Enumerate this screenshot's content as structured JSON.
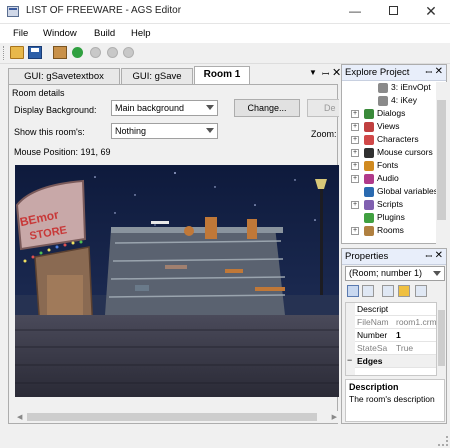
{
  "window": {
    "title": "LIST OF FREEWARE - AGS Editor",
    "minimize_glyph": "—",
    "close_glyph": "✕"
  },
  "menu": [
    "File",
    "Window",
    "Build",
    "Help"
  ],
  "toolbar": {
    "icons": [
      "open-folder-icon",
      "save-icon",
      "build-icon",
      "run-icon",
      "pause-icon",
      "stop-icon",
      "step-icon"
    ]
  },
  "tabs": [
    {
      "label": "GUI: gSavetextbox"
    },
    {
      "label": "GUI: gSave"
    },
    {
      "label": "Room 1"
    }
  ],
  "tab_controls": {
    "menu": "▼",
    "pin": "ꟷ",
    "close": "✕"
  },
  "room_editor": {
    "group_label": "Room details",
    "display_background_label": "Display Background:",
    "display_background_value": "Main background",
    "show_label": "Show this room's:",
    "show_value": "Nothing",
    "change_button": "Change...",
    "delete_button": "De",
    "zoom_label": "Zoom:",
    "mouse_position": "Mouse Position:  191, 69"
  },
  "room_image": {
    "sign_text_1": "BEmor",
    "sign_text_2": "STORE"
  },
  "explore": {
    "title": "Explore Project",
    "pin": "ꟷ",
    "close": "✕",
    "items": [
      {
        "label": "3: iEnvOpt",
        "icon": "page-icon",
        "indent": 2,
        "expander": "",
        "color": "#8a8a8a"
      },
      {
        "label": "4: iKey",
        "icon": "page-icon",
        "indent": 2,
        "expander": "",
        "color": "#8a8a8a"
      },
      {
        "label": "Dialogs",
        "icon": "dialog-icon",
        "indent": 0,
        "expander": "+",
        "color": "#3a8a3a"
      },
      {
        "label": "Views",
        "icon": "views-icon",
        "indent": 0,
        "expander": "+",
        "color": "#c04040"
      },
      {
        "label": "Characters",
        "icon": "characters-icon",
        "indent": 0,
        "expander": "+",
        "color": "#d04848"
      },
      {
        "label": "Mouse cursors",
        "icon": "cursor-icon",
        "indent": 0,
        "expander": "+",
        "color": "#303030"
      },
      {
        "label": "Fonts",
        "icon": "font-icon",
        "indent": 0,
        "expander": "+",
        "color": "#d08a20"
      },
      {
        "label": "Audio",
        "icon": "audio-icon",
        "indent": 0,
        "expander": "+",
        "color": "#b03a8a"
      },
      {
        "label": "Global variables",
        "icon": "globe-icon",
        "indent": 0,
        "expander": "",
        "color": "#2a6ab0"
      },
      {
        "label": "Scripts",
        "icon": "scripts-icon",
        "indent": 0,
        "expander": "+",
        "color": "#8060b0"
      },
      {
        "label": "Plugins",
        "icon": "plugin-icon",
        "indent": 0,
        "expander": "",
        "color": "#40a040"
      },
      {
        "label": "Rooms",
        "icon": "rooms-icon",
        "indent": 0,
        "expander": "+",
        "color": "#b08040"
      }
    ]
  },
  "properties": {
    "title": "Properties",
    "pin": "ꟷ",
    "close": "✕",
    "object_selector": "(Room; number 1)",
    "rows": [
      {
        "name": "Descript",
        "value": "",
        "gray": false
      },
      {
        "name": "FileNam",
        "value": "room1.crm",
        "gray": true
      },
      {
        "name": "Number",
        "value": "1",
        "gray": false,
        "bold": true
      },
      {
        "name": "StateSa",
        "value": "True",
        "gray": true
      },
      {
        "name": "Edges",
        "value": "",
        "category": true
      },
      {
        "name": "",
        "value": "",
        "gray": false
      }
    ],
    "description_title": "Description",
    "description_text": "The room's description"
  }
}
